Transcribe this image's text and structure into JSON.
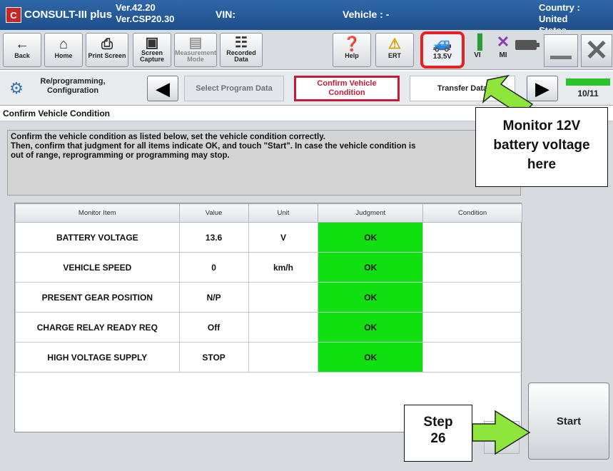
{
  "titlebar": {
    "app_name": "CONSULT-III plus",
    "version_line1": "Ver.42.20",
    "version_line2": "Ver.CSP20.30",
    "vin_label": "VIN:",
    "vehicle_label": "Vehicle : -",
    "country_line1": "Country : United",
    "country_line2": "States"
  },
  "toolbar": {
    "back": "Back",
    "home": "Home",
    "print_screen": "Print Screen",
    "screen_capture_1": "Screen",
    "screen_capture_2": "Capture",
    "measurement_1": "Measurement",
    "measurement_2": "Mode",
    "recorded_1": "Recorded",
    "recorded_2": "Data",
    "help": "Help",
    "ert": "ERT",
    "battery_voltage": "13.5V",
    "vi": "VI",
    "mi": "MI"
  },
  "stepbar": {
    "crumb_line1": "Re/programming,",
    "crumb_line2": "Configuration",
    "step_prev": "Select Program Data",
    "step_current_1": "Confirm Vehicle",
    "step_current_2": "Condition",
    "step_next": "Transfer Data",
    "page_indicator": "10/11"
  },
  "section_title": "Confirm Vehicle Condition",
  "instructions": {
    "line1": "Confirm the vehicle condition as listed below, set the vehicle condition correctly.",
    "line2": "Then, confirm that judgment for all items indicate OK, and touch \"Start\". In case the vehicle condition is",
    "line3": "out of range, reprogramming or programming may stop."
  },
  "table": {
    "headers": [
      "Monitor Item",
      "Value",
      "Unit",
      "Judgment",
      "Condition"
    ],
    "rows": [
      {
        "item": "BATTERY VOLTAGE",
        "value": "13.6",
        "unit": "V",
        "judgment": "OK",
        "condition": ""
      },
      {
        "item": "VEHICLE SPEED",
        "value": "0",
        "unit": "km/h",
        "judgment": "OK",
        "condition": ""
      },
      {
        "item": "PRESENT GEAR POSITION",
        "value": "N/P",
        "unit": "",
        "judgment": "OK",
        "condition": ""
      },
      {
        "item": "CHARGE RELAY READY REQ",
        "value": "Off",
        "unit": "",
        "judgment": "OK",
        "condition": ""
      },
      {
        "item": "HIGH VOLTAGE SUPPLY",
        "value": "STOP",
        "unit": "",
        "judgment": "OK",
        "condition": ""
      }
    ]
  },
  "start_label": "Start",
  "callouts": {
    "monitor_line1": "Monitor 12V",
    "monitor_line2": "battery voltage",
    "monitor_line3": "here",
    "step_line1": "Step",
    "step_line2": "26"
  },
  "colors": {
    "judgment_ok": "#10e010",
    "highlight_ring": "#e52222",
    "callout_arrow": "#8ee63c",
    "current_step": "#c8193a"
  }
}
